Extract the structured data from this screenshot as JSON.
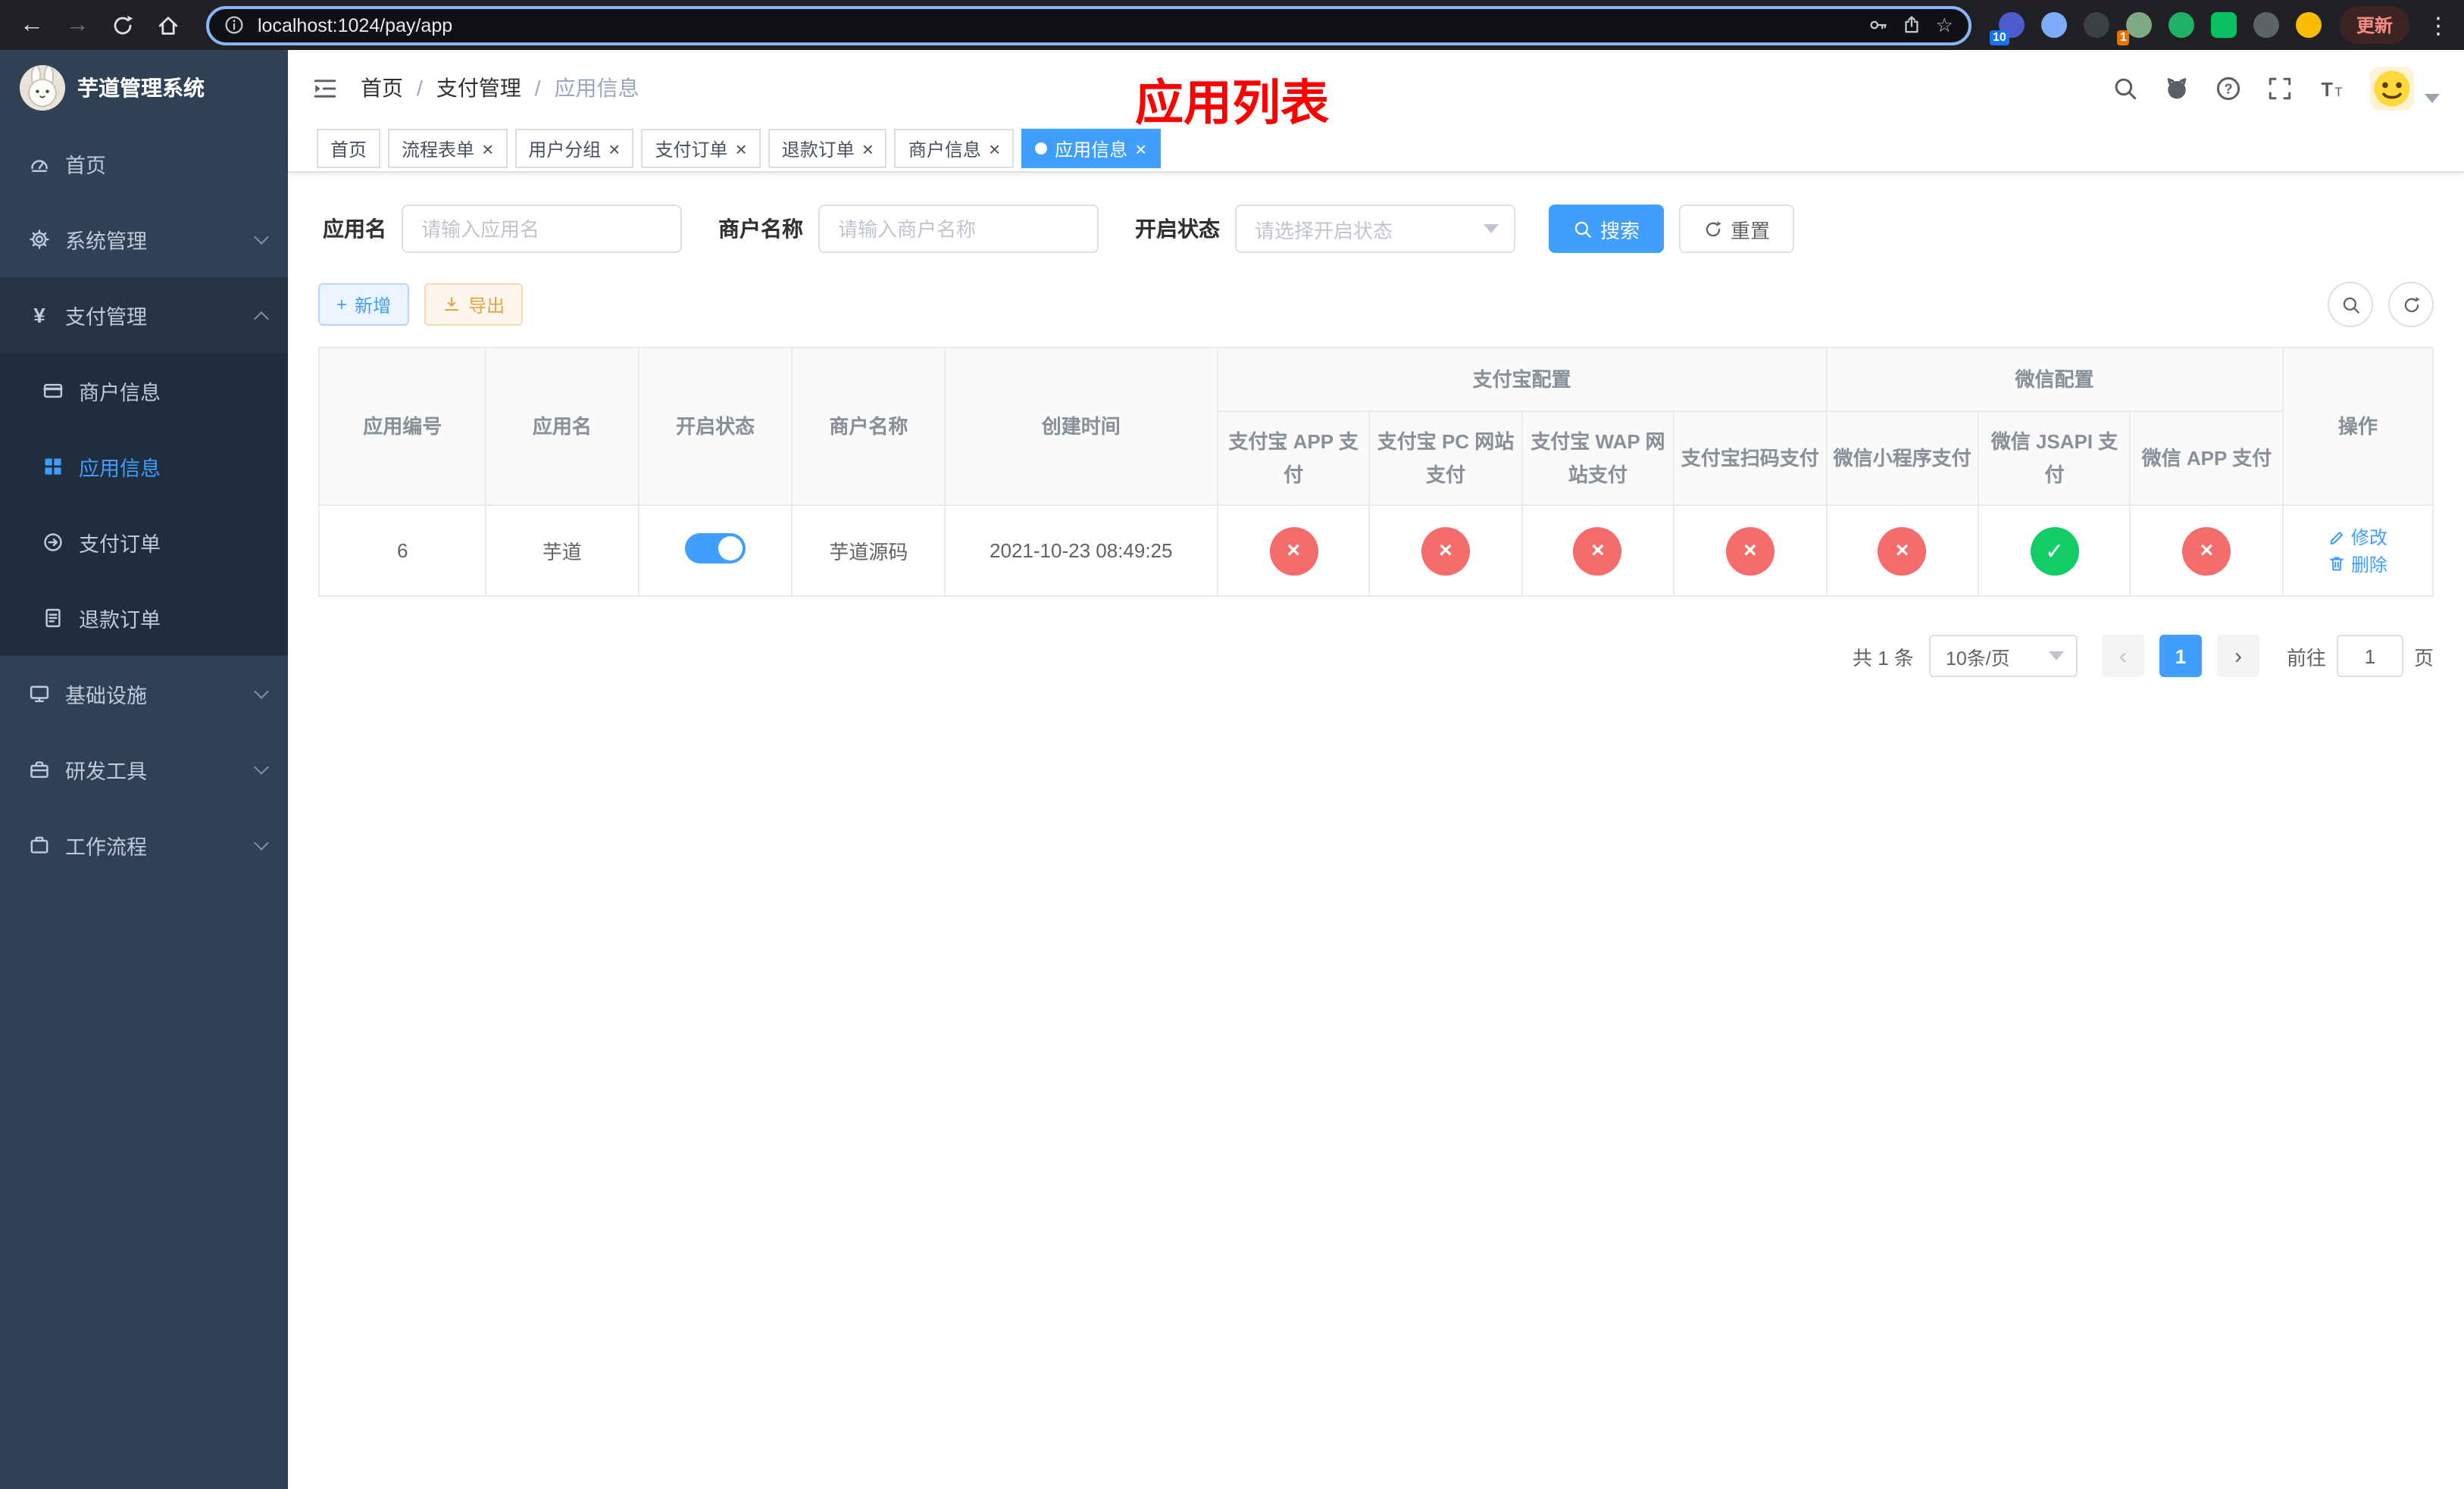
{
  "colors": {
    "accent": "#409EFF",
    "danger": "#F56C6C",
    "success": "#13CE66",
    "sidebar_bg": "#304156",
    "submenu_bg": "#1F2D3D",
    "title_red": "#FF0000"
  },
  "icons": {
    "back": "←",
    "forward": "→",
    "star": "☆",
    "plus": "+",
    "close": "×",
    "check": "✓",
    "cross": "×",
    "prev": "‹",
    "next": "›",
    "menu_dots": "⋮"
  },
  "browser": {
    "url": "localhost:1024/pay/app",
    "update_button": "更新",
    "extensions": [
      {
        "key": "extension-multicolor",
        "color": "#4d5bce",
        "badge": "10",
        "badge_color": "#1a73e8",
        "shape": "circle"
      },
      {
        "key": "extension-blue-drop",
        "color": "#7cacf8",
        "shape": "circle"
      },
      {
        "key": "extension-dark-globe",
        "color": "#3c4043",
        "shape": "circle"
      },
      {
        "key": "extension-profile",
        "color": "#7fa885",
        "badge": "1",
        "badge_color": "#e8710a",
        "shape": "circle"
      },
      {
        "key": "extension-green-circle",
        "color": "#1fb264",
        "shape": "circle"
      },
      {
        "key": "extension-green-chat",
        "color": "#07c160",
        "shape": "square"
      },
      {
        "key": "extension-dark-pin",
        "color": "#5f6368",
        "shape": "circle"
      },
      {
        "key": "extension-emoji-face",
        "color": "#fbbc04",
        "shape": "circle"
      }
    ]
  },
  "sidebar": {
    "logo_title": "芋道管理系统",
    "items": [
      {
        "key": "home",
        "label": "首页",
        "icon": "dashboard-icon",
        "type": "item"
      },
      {
        "key": "system",
        "label": "系统管理",
        "icon": "gear-icon",
        "type": "group",
        "expanded": false
      },
      {
        "key": "payment",
        "label": "支付管理",
        "icon": "yen-icon",
        "type": "group",
        "expanded": true,
        "children": [
          {
            "key": "merchant-info",
            "label": "商户信息",
            "icon": "card-icon",
            "active": false
          },
          {
            "key": "app-info",
            "label": "应用信息",
            "icon": "grid-icon",
            "active": true
          },
          {
            "key": "payment-order",
            "label": "支付订单",
            "icon": "order-icon",
            "active": false
          },
          {
            "key": "refund-order",
            "label": "退款订单",
            "icon": "refund-icon",
            "active": false
          }
        ]
      },
      {
        "key": "infrastructure",
        "label": "基础设施",
        "icon": "infra-icon",
        "type": "group",
        "expanded": false
      },
      {
        "key": "dev-tools",
        "label": "研发工具",
        "icon": "tools-icon",
        "type": "group",
        "expanded": false
      },
      {
        "key": "workflow",
        "label": "工作流程",
        "icon": "workflow-icon",
        "type": "group",
        "expanded": false
      }
    ]
  },
  "header": {
    "breadcrumb": [
      "首页",
      "支付管理",
      "应用信息"
    ],
    "page_title": "应用列表"
  },
  "tabs": [
    {
      "key": "home",
      "label": "首页",
      "closable": false,
      "active": false
    },
    {
      "key": "flow-form",
      "label": "流程表单",
      "closable": true,
      "active": false
    },
    {
      "key": "user-group",
      "label": "用户分组",
      "closable": true,
      "active": false
    },
    {
      "key": "payment-order",
      "label": "支付订单",
      "closable": true,
      "active": false
    },
    {
      "key": "refund-order",
      "label": "退款订单",
      "closable": true,
      "active": false
    },
    {
      "key": "merchant-info",
      "label": "商户信息",
      "closable": true,
      "active": false
    },
    {
      "key": "app-info",
      "label": "应用信息",
      "closable": true,
      "active": true
    }
  ],
  "filters": {
    "app_name_label": "应用名",
    "app_name_placeholder": "请输入应用名",
    "merchant_label": "商户名称",
    "merchant_placeholder": "请输入商户名称",
    "status_label": "开启状态",
    "status_placeholder": "请选择开启状态",
    "search_button": "搜索",
    "reset_button": "重置"
  },
  "toolbar": {
    "add_button": "新增",
    "export_button": "导出"
  },
  "table": {
    "simple_columns": [
      "应用编号",
      "应用名",
      "开启状态",
      "商户名称",
      "创建时间"
    ],
    "alipay_group": {
      "label": "支付宝配置",
      "children": [
        "支付宝 APP 支付",
        "支付宝 PC 网站支付",
        "支付宝 WAP 网站支付",
        "支付宝扫码支付"
      ]
    },
    "wechat_group": {
      "label": "微信配置",
      "children": [
        "微信小程序支付",
        "微信 JSAPI 支付",
        "微信 APP 支付"
      ]
    },
    "action_column": "操作",
    "config_keys": [
      "alipay-app",
      "alipay-pc",
      "alipay-wap",
      "alipay-qr",
      "wechat-mini",
      "wechat-jsapi",
      "wechat-app"
    ],
    "col_widths": [
      "7.9%",
      "7.2%",
      "7.3%",
      "7.2%",
      "12.9%",
      "7.2%",
      "7.2%",
      "7.2%",
      "7.2%",
      "7.2%",
      "7.2%",
      "7.2%",
      "7.1%"
    ],
    "rows": [
      {
        "id": "6",
        "name": "芋道",
        "enabled": true,
        "merchant": "芋道源码",
        "created": "2021-10-23 08:49:25",
        "configs": [
          false,
          false,
          false,
          false,
          false,
          true,
          false
        ],
        "edit_label": "修改",
        "delete_label": "删除"
      }
    ]
  },
  "pagination": {
    "total_text": "共 1 条",
    "page_size": "10条/页",
    "current_page": "1",
    "goto_prefix": "前往",
    "goto_value": "1",
    "goto_suffix": "页"
  }
}
